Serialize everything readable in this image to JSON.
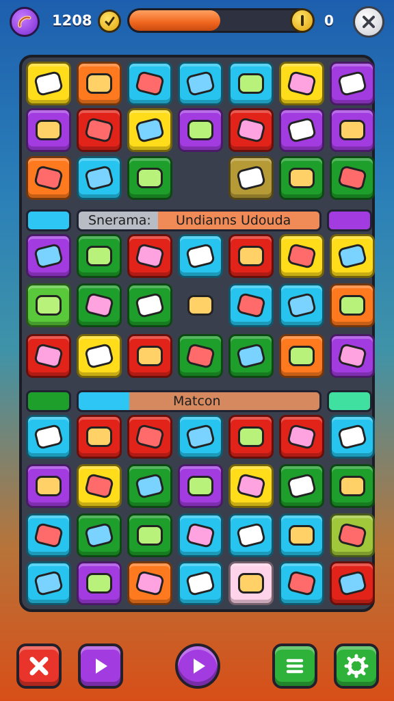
{
  "hud": {
    "score": "1208",
    "progress": 0.5,
    "coins": "0",
    "icons": {
      "avatar": "sausage-icon",
      "timer": "clock-icon",
      "coin": "coin-icon",
      "close": "close-icon"
    }
  },
  "board": {
    "rows": [
      [
        {
          "color": "#ffdd1a",
          "icon": "hammer-icon"
        },
        {
          "color": "#ff7a1e",
          "icon": "flower-icon"
        },
        {
          "color": "#26c4ef",
          "icon": "cheese-icon"
        },
        {
          "color": "#26c4ef",
          "icon": "brush-icon"
        },
        {
          "color": "#26c4ef",
          "icon": "book-icon"
        },
        {
          "color": "#ffdd1a",
          "icon": "radio-icon"
        },
        {
          "color": "#a23be0",
          "icon": "battery-icon"
        }
      ],
      [
        {
          "color": "#a23be0",
          "icon": "pickle-icon"
        },
        {
          "color": "#e2231a",
          "icon": "apple-icon"
        },
        {
          "color": "#ffdd1a",
          "icon": "candy-icon"
        },
        {
          "color": "#a23be0",
          "icon": "jar-icon"
        },
        {
          "color": "#e2231a",
          "icon": "stethoscope-icon"
        },
        {
          "color": "#a23be0",
          "icon": "leaf-icon"
        },
        {
          "color": "#a23be0",
          "icon": "car-icon"
        }
      ],
      [
        {
          "color": "#ff7a1e",
          "icon": "balloon-icon"
        },
        {
          "color": "#26c4ef",
          "icon": "fish-icon"
        },
        {
          "color": "#1e9e2a",
          "icon": "puddle-icon"
        },
        {
          "color": "",
          "icon": ""
        },
        {
          "color": "#b69a35",
          "icon": "paintbrush-icon"
        },
        {
          "color": "#1e9e2a",
          "icon": "bone-icon"
        },
        {
          "color": "#1e9e2a",
          "icon": "sun-icon"
        }
      ],
      [
        {
          "color": "#a23be0",
          "icon": "heart-icon"
        },
        {
          "color": "#1e9e2a",
          "icon": "bottle-icon"
        },
        {
          "color": "#e2231a",
          "icon": "donut-icon"
        },
        {
          "color": "#26c4ef",
          "icon": "pliers-icon"
        },
        {
          "color": "#e2231a",
          "icon": "lollipop-icon"
        },
        {
          "color": "#ffdd1a",
          "icon": "crayon-icon"
        },
        {
          "color": "#ffdd1a",
          "icon": "palm-tree-icon"
        }
      ],
      [
        {
          "color": "#59c83a",
          "icon": "shell-icon"
        },
        {
          "color": "#1e9e2a",
          "icon": "heart-outline-icon"
        },
        {
          "color": "#1e9e2a",
          "icon": "cup-icon"
        },
        {
          "color": "",
          "icon": "axe-icon"
        },
        {
          "color": "#26c4ef",
          "icon": "pot-icon"
        },
        {
          "color": "#26c4ef",
          "icon": "paper-icon"
        },
        {
          "color": "#ff7a1e",
          "icon": "umbrella-icon"
        }
      ],
      [
        {
          "color": "#e2231a",
          "icon": "gear-icon"
        },
        {
          "color": "#ffdd1a",
          "icon": "mushroom-icon"
        },
        {
          "color": "#e2231a",
          "icon": "lime-icon"
        },
        {
          "color": "#1e9e2a",
          "icon": "keyboard-icon"
        },
        {
          "color": "#1e9e2a",
          "icon": "sun-icon"
        },
        {
          "color": "#ff7a1e",
          "icon": "eraser-icon"
        },
        {
          "color": "#a23be0",
          "icon": "jar-icon"
        }
      ],
      [
        {
          "color": "#26c4ef",
          "icon": "tape-icon"
        },
        {
          "color": "#e2231a",
          "icon": "spoon-icon"
        },
        {
          "color": "#e2231a",
          "icon": "cake-slice-icon"
        },
        {
          "color": "#26c4ef",
          "icon": "marshmallow-icon"
        },
        {
          "color": "#e2231a",
          "icon": "mask-icon"
        },
        {
          "color": "#e2231a",
          "icon": "cog-icon"
        },
        {
          "color": "#26c4ef",
          "icon": "chicken-icon"
        }
      ],
      [
        {
          "color": "#a23be0",
          "icon": "gear-icon"
        },
        {
          "color": "#ffdd1a",
          "icon": "flower-icon"
        },
        {
          "color": "#1e9e2a",
          "icon": "cassette-icon"
        },
        {
          "color": "#a23be0",
          "icon": "pen-icon"
        },
        {
          "color": "#ffdd1a",
          "icon": "feather-icon"
        },
        {
          "color": "#1e9e2a",
          "icon": "bell-icon"
        },
        {
          "color": "#1e9e2a",
          "icon": "star-icon"
        }
      ],
      [
        {
          "color": "#26c4ef",
          "icon": "heart-icon"
        },
        {
          "color": "#1e9e2a",
          "icon": "leaf-icon"
        },
        {
          "color": "#1e9e2a",
          "icon": "pencil-icon"
        },
        {
          "color": "#26c4ef",
          "icon": "battery-icon"
        },
        {
          "color": "#26c4ef",
          "icon": "car-icon"
        },
        {
          "color": "#26c4ef",
          "icon": "pencil-icon"
        },
        {
          "color": "#a0c83a",
          "icon": "radio-icon"
        }
      ],
      [
        {
          "color": "#26c4ef",
          "icon": "washing-machine-icon"
        },
        {
          "color": "#a23be0",
          "icon": "cog-icon"
        },
        {
          "color": "#ff7a1e",
          "icon": "cheese-icon"
        },
        {
          "color": "#26c4ef",
          "icon": "bug-icon"
        },
        {
          "color": "#ffd4ea",
          "icon": "camera-icon"
        },
        {
          "color": "#26c4ef",
          "icon": "flashlight-icon"
        },
        {
          "color": "#e2231a",
          "icon": "splash-icon"
        }
      ]
    ]
  },
  "banner1": {
    "label_left": "Snerama:",
    "label_right": "Undianns Udouda"
  },
  "banner2": {
    "label": "Matcon"
  },
  "bottom": {
    "buttons": [
      {
        "name": "tools-button",
        "icon": "tools-icon",
        "color": "#e8342a"
      },
      {
        "name": "play-button",
        "icon": "play-icon",
        "color": "#a23be0"
      },
      {
        "name": "play-round-button",
        "icon": "play-icon",
        "color": "#a23be0"
      },
      {
        "name": "menu-button",
        "icon": "menu-icon",
        "color": "#2fb23a"
      },
      {
        "name": "settings-button",
        "icon": "gear-icon",
        "color": "#2fb23a"
      }
    ]
  }
}
